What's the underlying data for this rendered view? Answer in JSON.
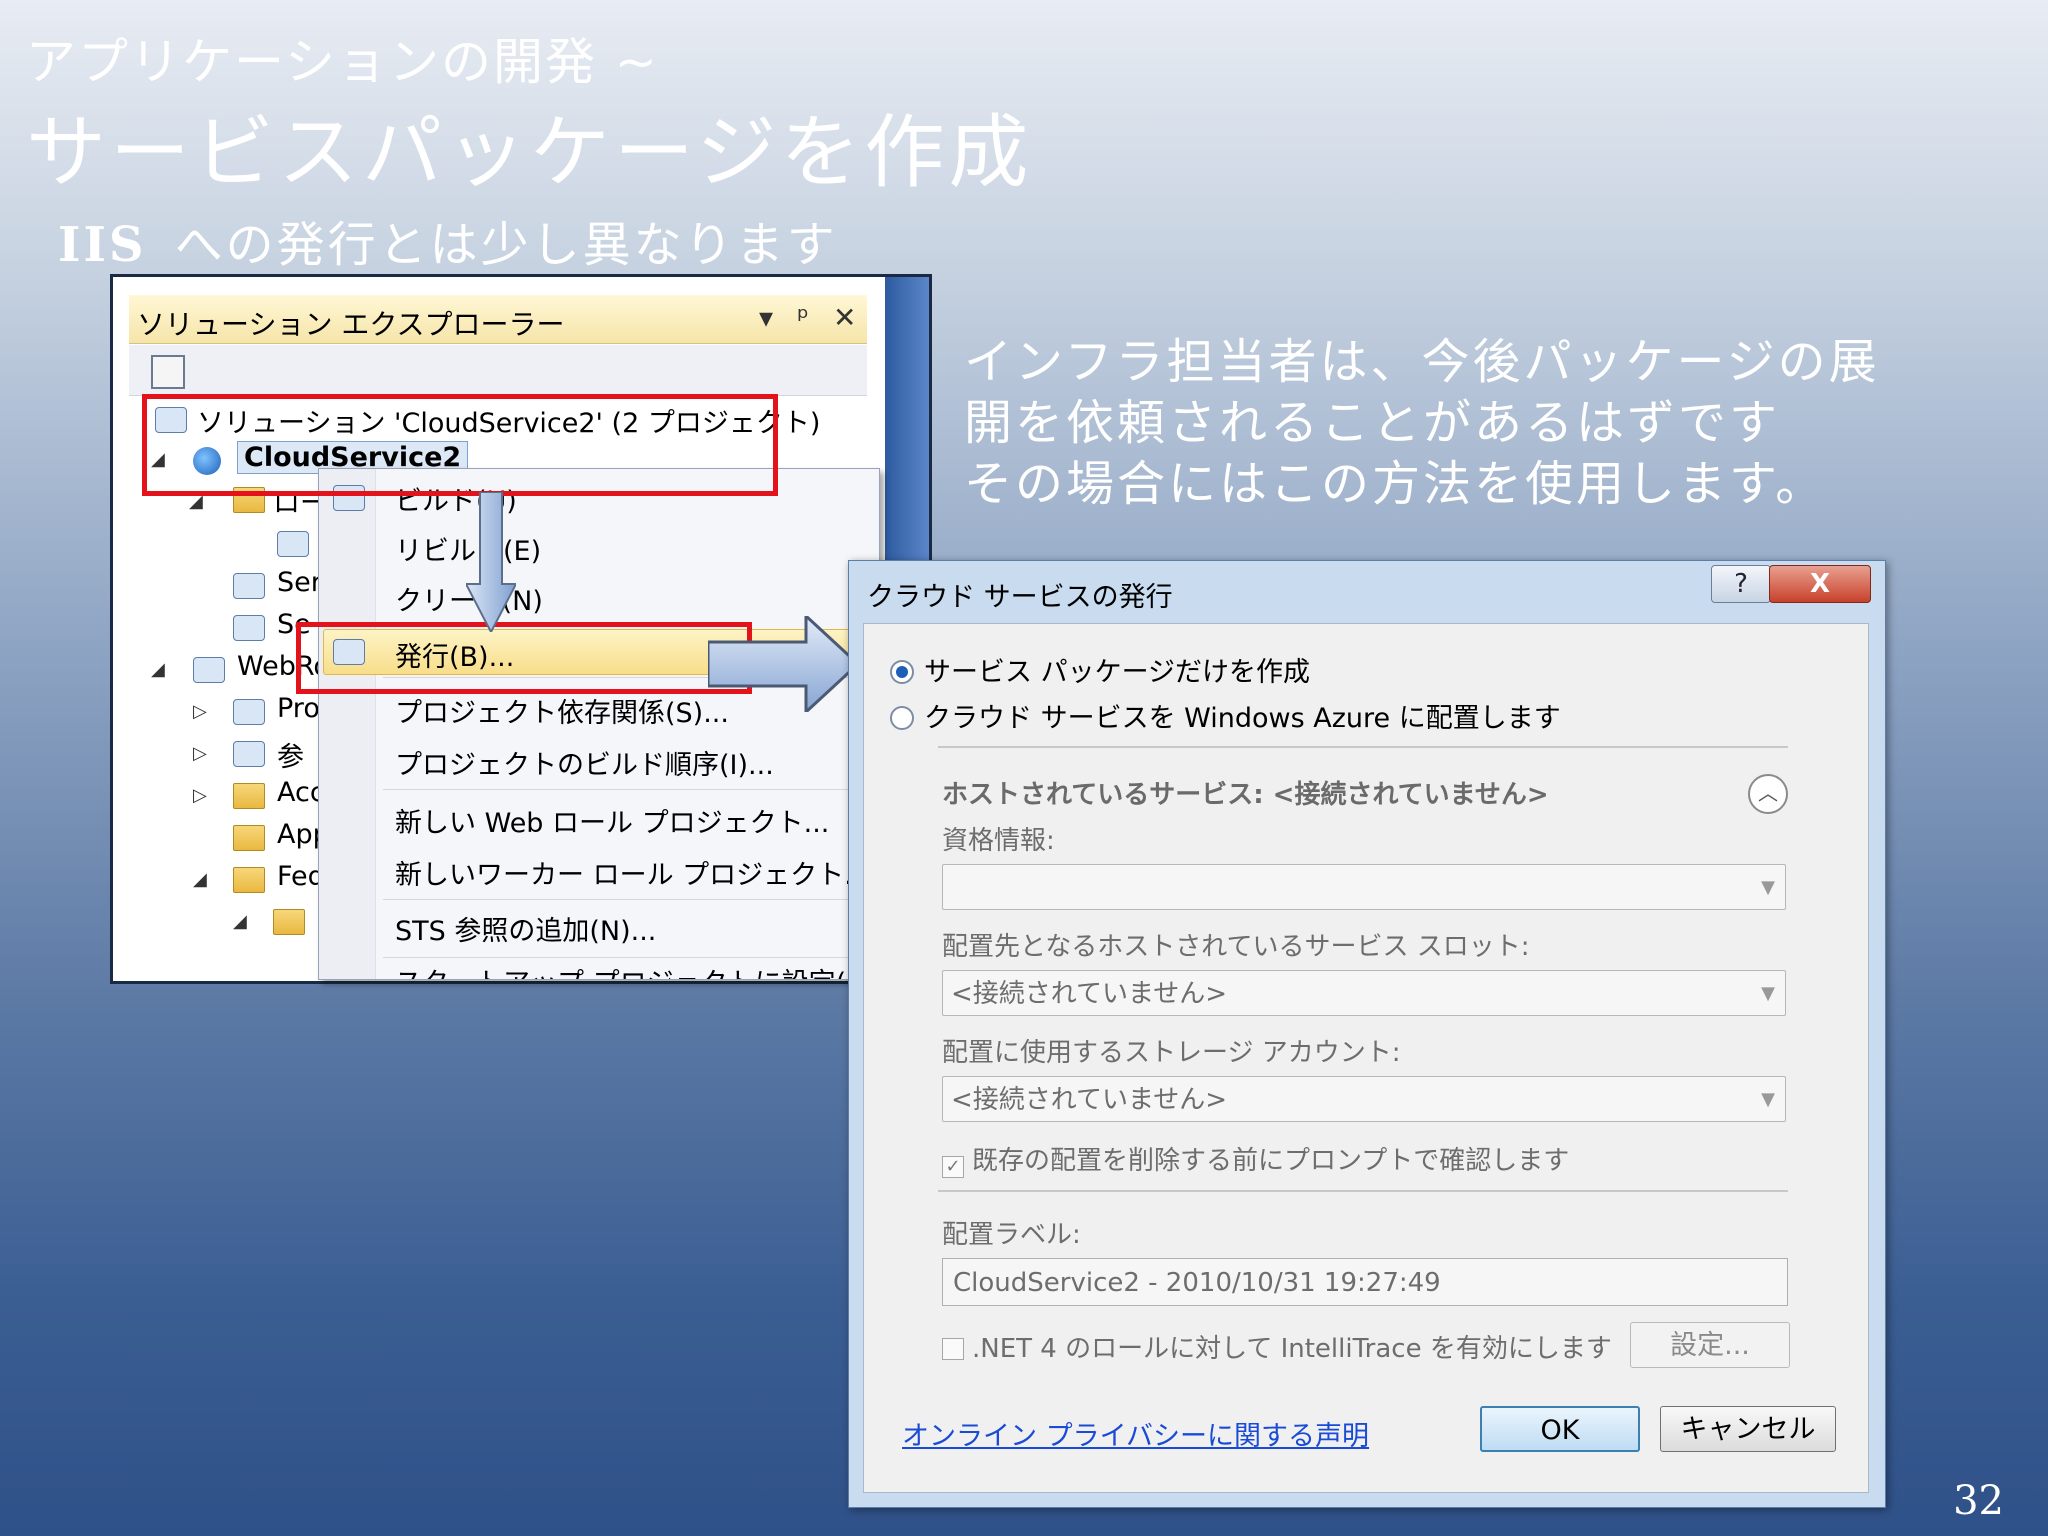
{
  "slide": {
    "subtitle": "アプリケーションの開発 ~",
    "title": "サービスパッケージを作成",
    "bullet_prefix": "IIS",
    "bullet_text": "への発行とは少し異なります",
    "note_lines": [
      "インフラ担当者は、今後パッケージの展",
      "開を依頼されることがあるはずです",
      "その場合にはこの方法を使用します。"
    ],
    "page_number": "32"
  },
  "solution_explorer": {
    "title": "ソリューション エクスプローラー",
    "title_controls": [
      "▾",
      "ᵖ",
      "✕"
    ],
    "tree": [
      {
        "label": "ソリューション 'CloudService2' (2 プロジェクト)"
      },
      {
        "label": "CloudService2"
      },
      {
        "label": "ロー"
      },
      {
        "label": ""
      },
      {
        "label": "Ser"
      },
      {
        "label": "Se"
      },
      {
        "label": "WebRo"
      },
      {
        "label": "Pro"
      },
      {
        "label": "参"
      },
      {
        "label": "Acc"
      },
      {
        "label": "App"
      },
      {
        "label": "Fed"
      },
      {
        "label": ""
      }
    ]
  },
  "context_menu": {
    "items": [
      {
        "label": "ビルド(U)"
      },
      {
        "label": "リビルド(E)"
      },
      {
        "label": "クリーン(N)"
      },
      {
        "label": "発行(B)..."
      },
      {
        "label": "プロジェクト依存関係(S)..."
      },
      {
        "label": "プロジェクトのビルド順序(I)..."
      },
      {
        "label": "新しい Web ロール プロジェクト..."
      },
      {
        "label": "新しいワーカー ロール プロジェクト..."
      },
      {
        "label": "STS 参照の追加(N)..."
      },
      {
        "label": "スタートアップ プロジェクトに設定(A)"
      }
    ]
  },
  "dialog": {
    "title": "クラウド サービスの発行",
    "help_label": "?",
    "close_label": "X",
    "option_package": "サービス パッケージだけを作成",
    "option_deploy": "クラウド サービスを Windows Azure に配置します",
    "hosted_service": "ホストされているサービス: <接続されていません>",
    "credentials_label": "資格情報:",
    "credentials_value": "",
    "slot_label": "配置先となるホストされているサービス スロット:",
    "slot_value": "<接続されていません>",
    "storage_label": "配置に使用するストレージ アカウント:",
    "storage_value": "<接続されていません>",
    "confirm_delete": "既存の配置を削除する前にプロンプトで確認します",
    "deploy_label": "配置ラベル:",
    "deploy_value": "CloudService2 - 2010/10/31 19:27:49",
    "intellitrace": ".NET 4 のロールに対して IntelliTrace を有効にします",
    "settings_button": "設定...",
    "privacy_link": "オンライン プライバシーに関する声明",
    "ok": "OK",
    "cancel": "キャンセル"
  }
}
